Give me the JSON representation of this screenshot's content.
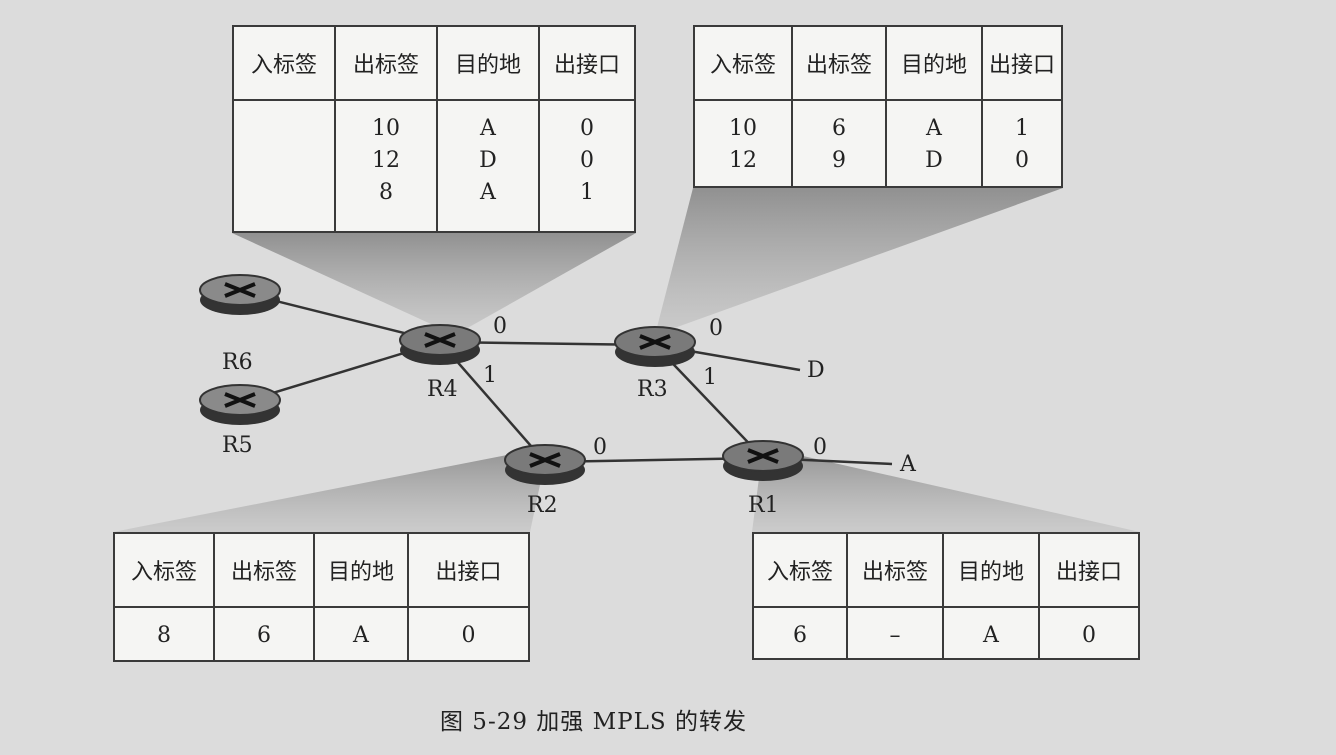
{
  "colors": {
    "router_fill": "#777",
    "router_dark": "#333",
    "link": "#333",
    "bg": "#dcdcdc"
  },
  "headers": [
    "入标签",
    "出标签",
    "目的地",
    "出接口"
  ],
  "tables": {
    "R4": [
      [
        "",
        "10",
        "A",
        "0"
      ],
      [
        "",
        "12",
        "D",
        "0"
      ],
      [
        "",
        "8",
        "A",
        "1"
      ]
    ],
    "R3": [
      [
        "10",
        "6",
        "A",
        "1"
      ],
      [
        "12",
        "9",
        "D",
        "0"
      ]
    ],
    "R2": [
      [
        "8",
        "6",
        "A",
        "0"
      ]
    ],
    "R1": [
      [
        "6",
        "–",
        "A",
        "0"
      ]
    ]
  },
  "routers": [
    "R6",
    "R5",
    "R4",
    "R3",
    "R2",
    "R1"
  ],
  "ports": {
    "r4_0": "0",
    "r4_1": "1",
    "r3_0": "0",
    "r3_1": "1",
    "r2_0": "0",
    "r1_0": "0"
  },
  "destinations": {
    "d": "D",
    "a": "A"
  },
  "caption": "图 5-29   加强 MPLS 的转发"
}
